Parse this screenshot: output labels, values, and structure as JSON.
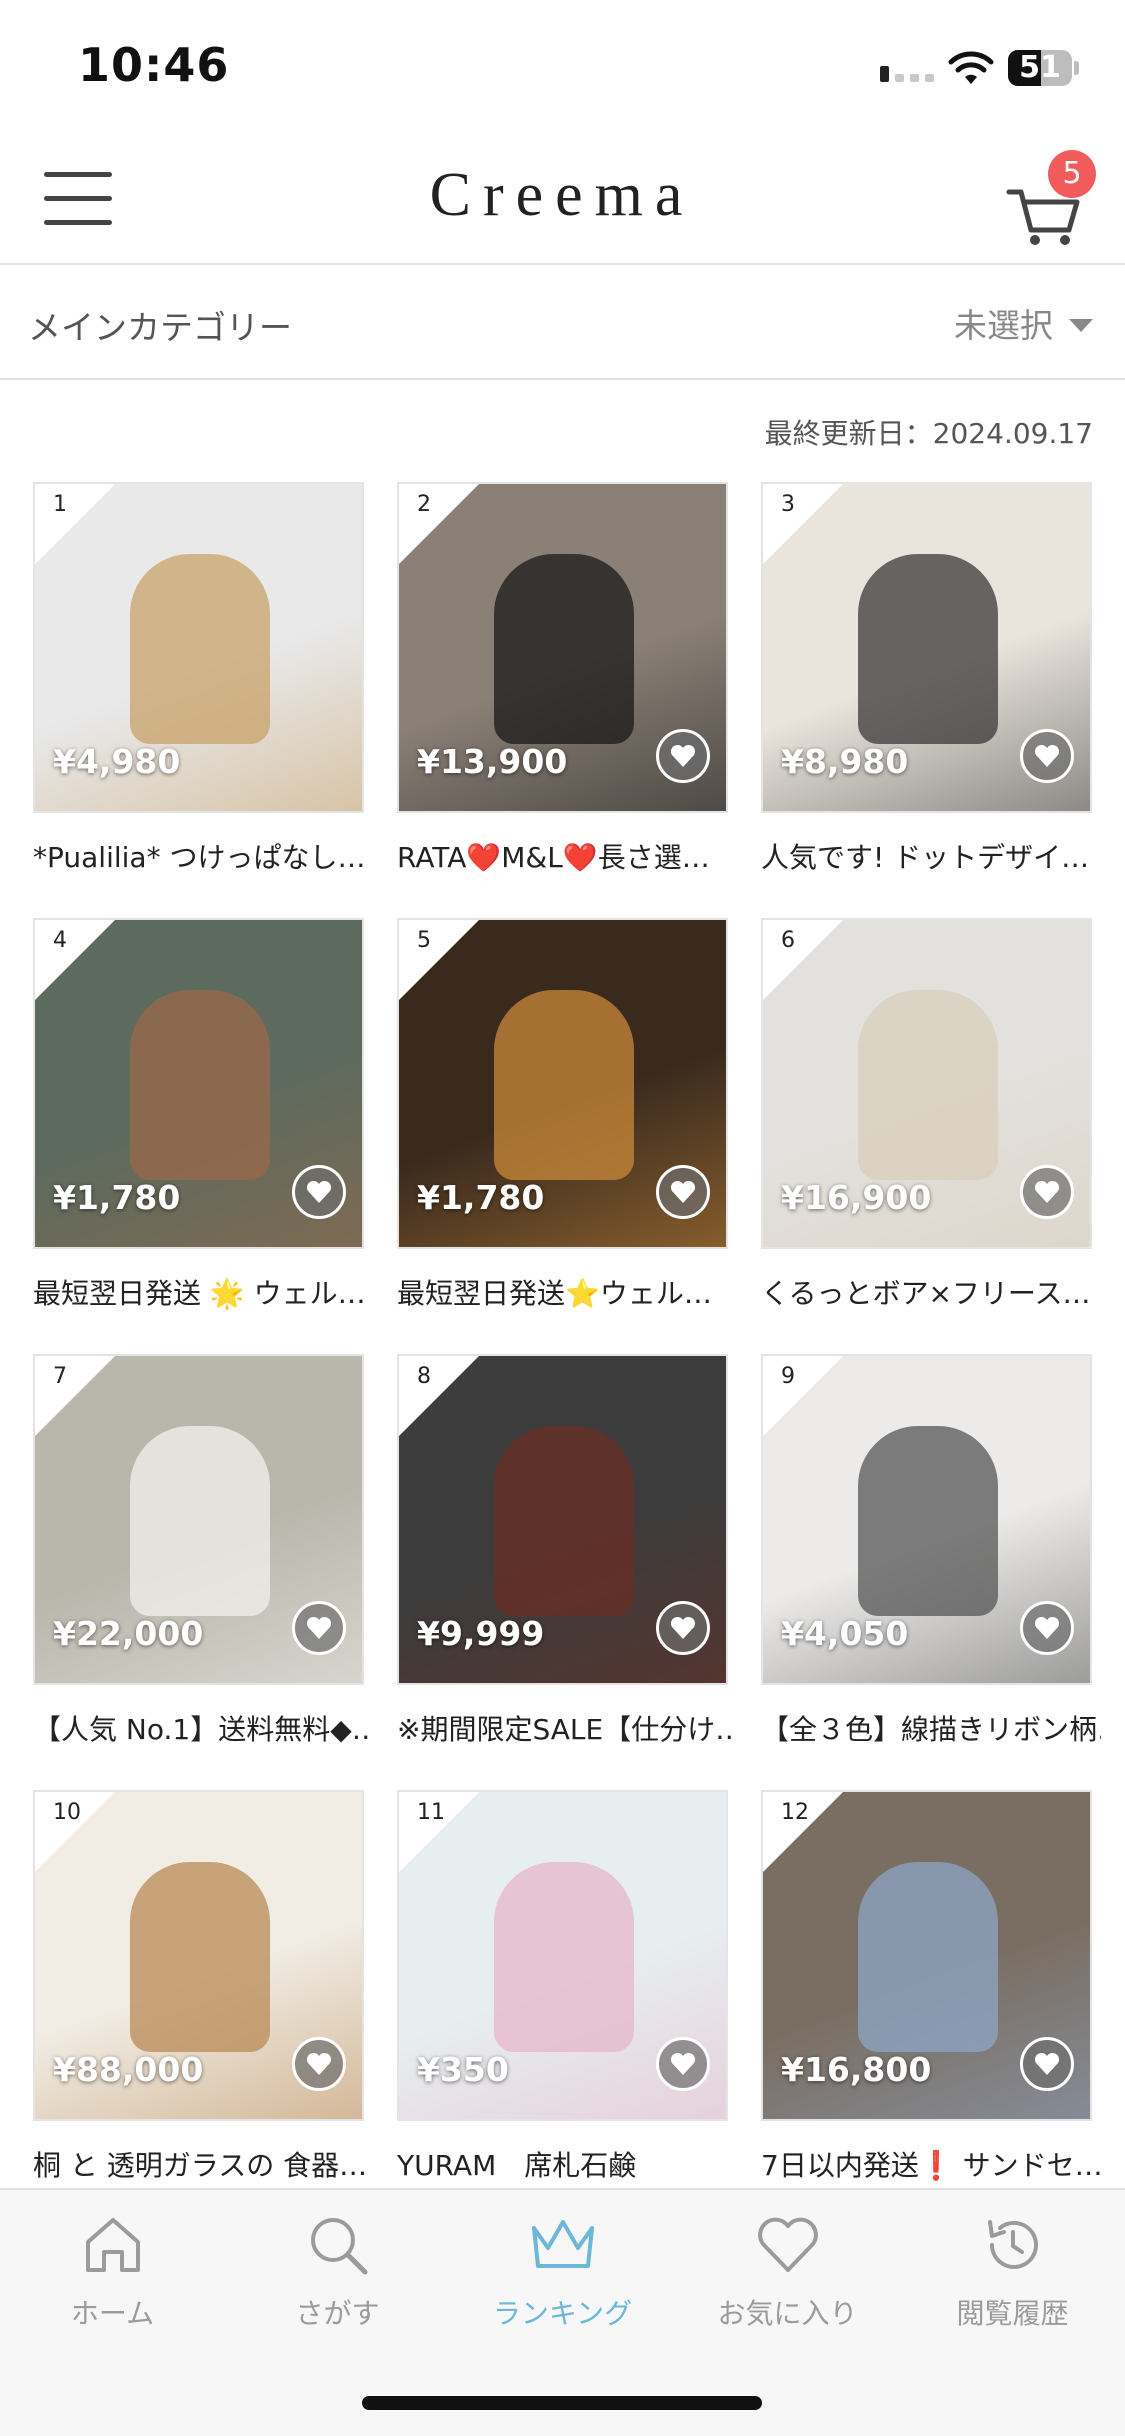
{
  "status_bar": {
    "time": "10:46",
    "battery": "51",
    "battery_level": 0.51
  },
  "header": {
    "logo": "Creema",
    "cart_count": "5"
  },
  "category": {
    "label": "メインカテゴリー",
    "value": "未選択"
  },
  "last_updated": "最終更新日：2024.09.17",
  "products": [
    {
      "rank": "1",
      "price": "¥4,980",
      "title": "*Pualilia* つけっぱなし…",
      "bg": "#e9e9ea",
      "accent": "#c8a26a"
    },
    {
      "rank": "2",
      "price": "¥13,900",
      "title": "RATA❤️M&L❤️長さ選…",
      "bg": "#8a8076",
      "accent": "#1a1a1a"
    },
    {
      "rank": "3",
      "price": "¥8,980",
      "title": "人気です! ドットデザイ…",
      "bg": "#e9e4dc",
      "accent": "#3a3a3a"
    },
    {
      "rank": "4",
      "price": "¥1,780",
      "title": "最短翌日発送 🌟 ウェル…",
      "bg": "#5d6a5e",
      "accent": "#9a6a4a"
    },
    {
      "rank": "5",
      "price": "¥1,780",
      "title": "最短翌日発送⭐ウェル…",
      "bg": "#3a2a1e",
      "accent": "#c98a3a"
    },
    {
      "rank": "6",
      "price": "¥16,900",
      "title": "くるっとボア×フリース…",
      "bg": "#e3e1dd",
      "accent": "#d8cdbb"
    },
    {
      "rank": "7",
      "price": "¥22,000",
      "title": "【人気 No.1】送料無料◆…",
      "bg": "#b9b6ac",
      "accent": "#f2f0ec"
    },
    {
      "rank": "8",
      "price": "¥9,999",
      "title": "※期間限定SALE【仕分け…",
      "bg": "#3c3c3c",
      "accent": "#6a2e24"
    },
    {
      "rank": "9",
      "price": "¥4,050",
      "title": "【全３色】線描きリボン柄…",
      "bg": "#ecebe9",
      "accent": "#555555"
    },
    {
      "rank": "10",
      "price": "¥88,000",
      "title": "桐 と 透明ガラスの 食器…",
      "bg": "#f1ece4",
      "accent": "#b98a55"
    },
    {
      "rank": "11",
      "price": "¥350",
      "title": "YURAM　席札石鹸",
      "bg": "#e7eef0",
      "accent": "#e6b6c9"
    },
    {
      "rank": "12",
      "price": "¥16,800",
      "title": "7日以内発送❗ サンドセ…",
      "bg": "#7a6e62",
      "accent": "#8fa6c6"
    }
  ],
  "tabs": [
    {
      "label": "ホーム",
      "icon": "home-icon"
    },
    {
      "label": "さがす",
      "icon": "search-icon"
    },
    {
      "label": "ランキング",
      "icon": "crown-icon",
      "active": true
    },
    {
      "label": "お気に入り",
      "icon": "heart-icon"
    },
    {
      "label": "閲覧履歴",
      "icon": "history-icon"
    }
  ],
  "colors": {
    "accent": "#6bb8d8",
    "badge": "#f25b5b",
    "inactive": "#9b9b9b"
  }
}
